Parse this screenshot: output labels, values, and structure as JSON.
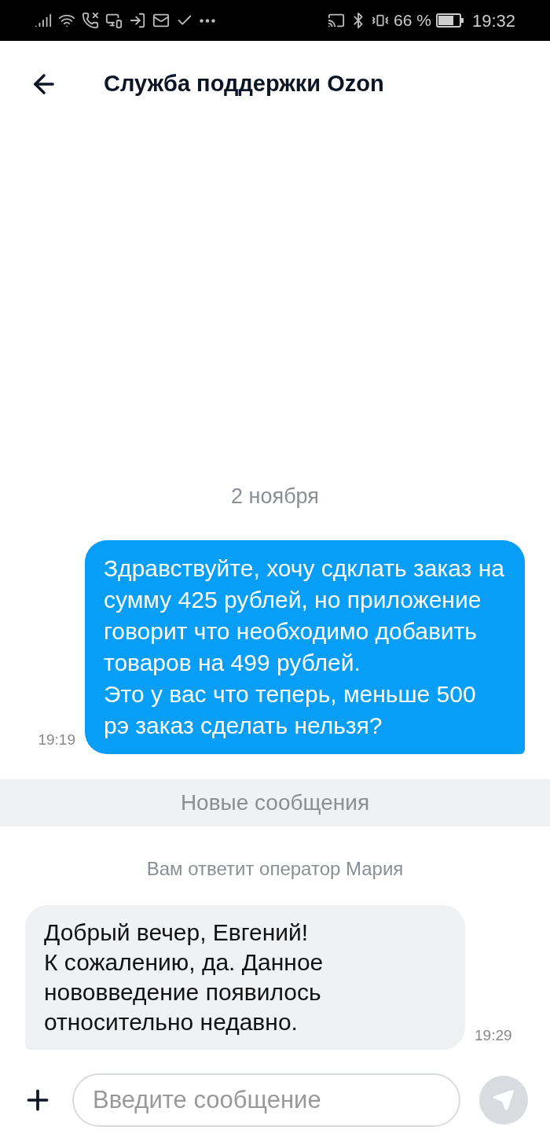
{
  "status_bar": {
    "battery_text": "66 %",
    "time": "19:32"
  },
  "header": {
    "title": "Служба поддержки Ozon"
  },
  "date_divider": "2 ноября",
  "messages": [
    {
      "kind": "outgoing",
      "text": "Здравствуйте, хочу сдклать заказ на сумму 425 рублей, но приложение говорит что необходимо добавить товаров на 499 рублей.\nЭто у вас что теперь, меньше 500 рэ заказ сделать нельзя?",
      "time": "19:19"
    },
    {
      "kind": "banner",
      "text": "Новые сообщения"
    },
    {
      "kind": "system",
      "text": "Вам ответит оператор Мария"
    },
    {
      "kind": "incoming",
      "text": "Добрый вечер, Евгений!\nК сожалению, да. Данное нововведение появилось относительно недавно.",
      "time": "19:29"
    }
  ],
  "composer": {
    "placeholder": "Введите сообщение"
  }
}
